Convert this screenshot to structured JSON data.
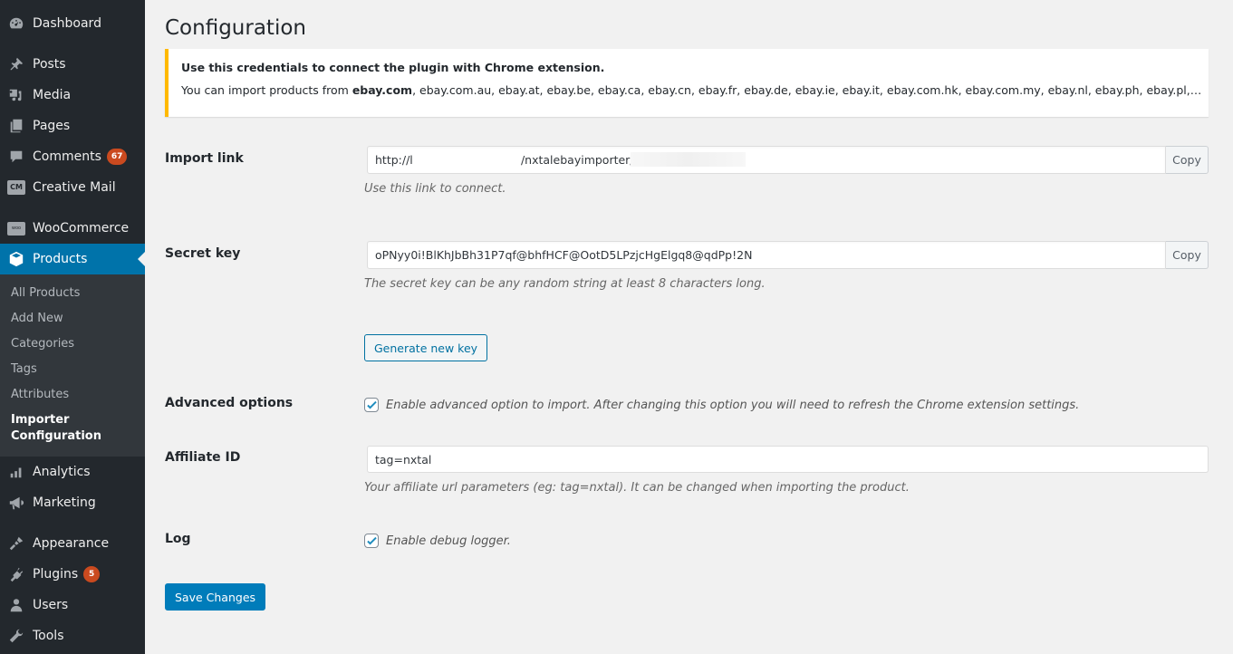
{
  "sidebar": {
    "items": [
      {
        "label": "Dashboard",
        "icon": "dashboard-icon"
      },
      {
        "label": "Posts",
        "icon": "pin-icon"
      },
      {
        "label": "Media",
        "icon": "media-icon"
      },
      {
        "label": "Pages",
        "icon": "pages-icon"
      },
      {
        "label": "Comments",
        "icon": "comment-icon",
        "badge": "67"
      },
      {
        "label": "Creative Mail",
        "icon": "creative-mail-icon",
        "icon_text": "CM"
      },
      {
        "label": "WooCommerce",
        "icon": "woocommerce-icon",
        "icon_text": "woo"
      },
      {
        "label": "Products",
        "icon": "products-box-icon",
        "active": true
      },
      {
        "label": "Analytics",
        "icon": "bar-chart-icon"
      },
      {
        "label": "Marketing",
        "icon": "megaphone-icon"
      },
      {
        "label": "Appearance",
        "icon": "paintbrush-icon"
      },
      {
        "label": "Plugins",
        "icon": "plug-icon",
        "badge": "5"
      },
      {
        "label": "Users",
        "icon": "user-icon"
      },
      {
        "label": "Tools",
        "icon": "wrench-icon"
      }
    ],
    "submenu": [
      {
        "label": "All Products"
      },
      {
        "label": "Add New"
      },
      {
        "label": "Categories"
      },
      {
        "label": "Tags"
      },
      {
        "label": "Attributes"
      },
      {
        "label": "Importer Configuration",
        "line1": "Importer",
        "line2": "Configuration",
        "current": true
      }
    ]
  },
  "page": {
    "title": "Configuration",
    "notice": {
      "title": "Use this credentials to connect the plugin with Chrome extension.",
      "text_prefix": "You can import products from ",
      "text_bold": "ebay.com",
      "text_rest": ", ebay.com.au, ebay.at, ebay.be, ebay.ca, ebay.cn, ebay.fr, ebay.de, ebay.ie, ebay.it, ebay.com.hk, ebay.com.my, ebay.nl, ebay.ph, ebay.pl, ebay.com.sg, ebay.es, ebay.ch, ebay.co.uk"
    },
    "import_link": {
      "label": "Import link",
      "value": "http://l                              /nxtalebayimporter/",
      "copy_label": "Copy",
      "description": "Use this link to connect."
    },
    "secret_key": {
      "label": "Secret key",
      "value": "oPNyy0i!BlKhJbBh31P7qf@bhfHCF@OotD5LPzjcHgElgq8@qdPp!2N",
      "copy_label": "Copy",
      "description": "The secret key can be any random string at least 8 characters long.",
      "generate_label": "Generate new key"
    },
    "advanced_options": {
      "label": "Advanced options",
      "checked": true,
      "checkbox_label": "Enable advanced option to import. After changing this option you will need to refresh the Chrome extension settings."
    },
    "affiliate_id": {
      "label": "Affiliate ID",
      "value": "tag=nxtal",
      "description": "Your affiliate url parameters (eg: tag=nxtal). It can be changed when importing the product."
    },
    "log": {
      "label": "Log",
      "checked": true,
      "checkbox_label": "Enable debug logger."
    },
    "save_label": "Save Changes"
  },
  "colors": {
    "sidebar_bg": "#23282d",
    "submenu_bg": "#32373c",
    "active_blue": "#0073aa",
    "notice_accent": "#ffb900",
    "badge": "#ca4a1f",
    "primary_button": "#007cba",
    "checkbox_check": "#1e8cbe"
  }
}
